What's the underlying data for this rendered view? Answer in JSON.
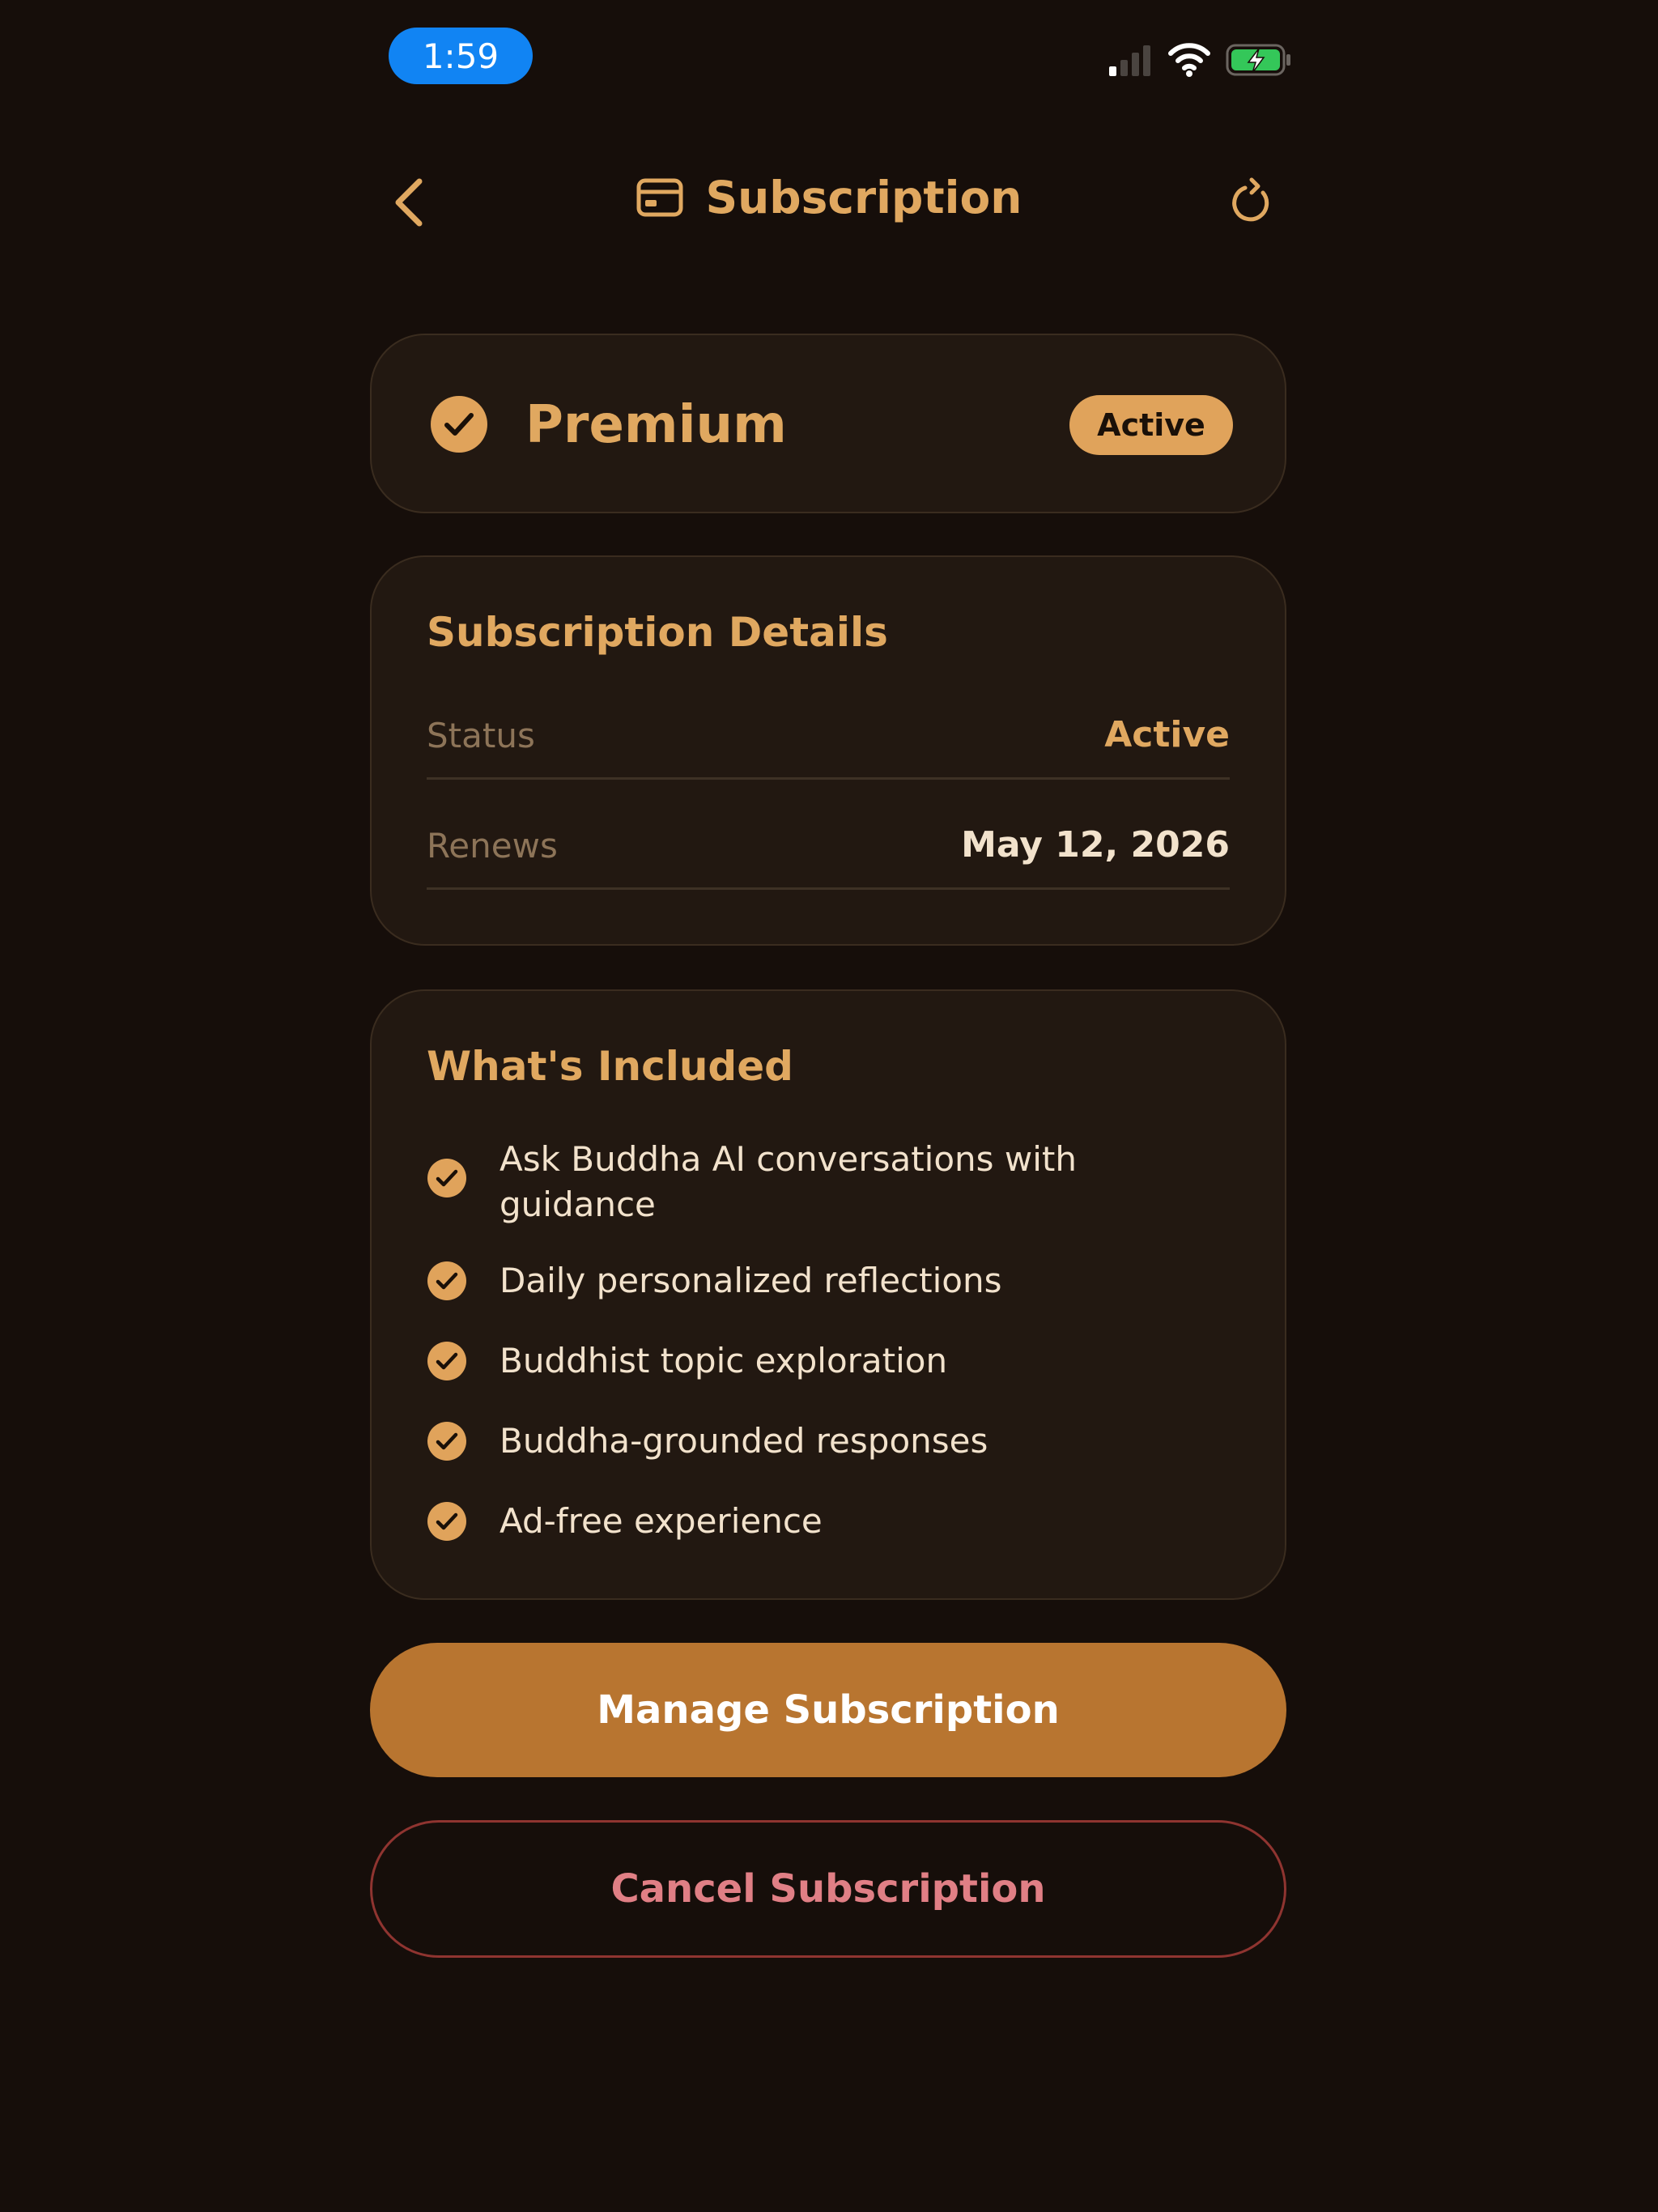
{
  "status_bar": {
    "time": "1:59",
    "icons": [
      "cellular-signal-icon",
      "wifi-icon",
      "battery-charging-icon"
    ]
  },
  "header": {
    "title": "Subscription",
    "title_icon": "credit-card-icon",
    "left_action_icon": "chevron-left-icon",
    "right_action_icon": "refresh-icon"
  },
  "plan": {
    "icon": "check-circle-icon",
    "name": "Premium",
    "badge": "Active"
  },
  "details": {
    "title": "Subscription Details",
    "rows": [
      {
        "label": "Status",
        "value": "Active"
      },
      {
        "label": "Renews",
        "value": "May 12, 2026"
      }
    ]
  },
  "included": {
    "title": "What's Included",
    "features": [
      "Ask Buddha AI conversations with guidance",
      "Daily personalized reflections",
      "Buddhist topic exploration",
      "Buddha-grounded responses",
      "Ad-free experience"
    ]
  },
  "actions": {
    "manage_label": "Manage Subscription",
    "cancel_label": "Cancel Subscription"
  },
  "colors": {
    "background": "#160e0a",
    "card": "#221811",
    "accent": "#e0a860",
    "primary_button": "#b87530",
    "danger_text": "#e07f85",
    "danger_border": "#8f3430",
    "status_time_pill": "#1184f3"
  }
}
